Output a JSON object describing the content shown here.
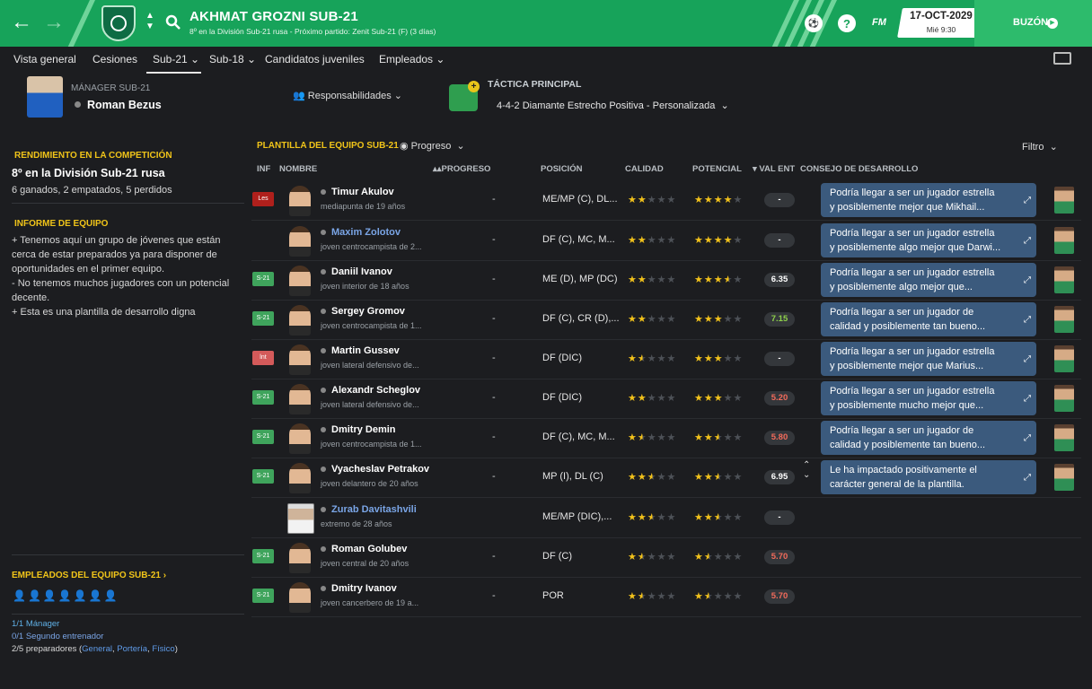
{
  "header": {
    "club": "AKHMAT GROZNI SUB-21",
    "subtitle": "8º en la División Sub-21 rusa - Próximo partido: Zenit Sub-21 (F)  (3 días)",
    "fm": "FM",
    "date": "17-OCT-2029",
    "time": "Mié 9:30",
    "inbox": "BUZÓN"
  },
  "tabs": [
    "Vista general",
    "Cesiones",
    "Sub-21",
    "Sub-18",
    "Candidatos juveniles",
    "Empleados"
  ],
  "manager": {
    "label": "MÁNAGER SUB-21",
    "name": "Roman Bezus",
    "responsibilities": "Responsabilidades"
  },
  "tactic": {
    "label": "TÁCTICA PRINCIPAL",
    "value": "4-4-2 Diamante Estrecho Positiva - Personalizada"
  },
  "competition": {
    "title": "RENDIMIENTO EN LA COMPETICIÓN",
    "position": "8º en la División Sub-21 rusa",
    "record": "6 ganados, 2 empatados, 5 perdidos"
  },
  "report": {
    "title": "INFORME DE EQUIPO",
    "lines": [
      "+ Tenemos aquí un grupo de jóvenes que están",
      "cerca de estar preparados ya para disponer de",
      "oportunidades en el primer equipo.",
      "- No tenemos muchos jugadores con un potencial",
      "decente.",
      "+ Esta es una plantilla de desarrollo digna"
    ]
  },
  "squad": {
    "title": "PLANTILLA DEL EQUIPO SUB-21",
    "view": "Progreso",
    "filter": "Filtro",
    "columns": {
      "inf": "INF",
      "name": "NOMBRE",
      "progress": "PROGRESO",
      "position": "POSICIÓN",
      "ability": "CALIDAD",
      "potential": "POTENCIAL",
      "value": "VAL ENT",
      "advice": "CONSEJO DE DESARROLLO"
    },
    "players": [
      {
        "inf": "Les",
        "inf_type": "les",
        "name": "Timur Akulov",
        "loan": false,
        "desc": "mediapunta de 19 años",
        "progress": "-",
        "position": "ME/MP (C), DL...",
        "ability": 2,
        "potential": 4,
        "rating": "-",
        "rating_color": "#ffffff",
        "advice": [
          "Podría llegar a ser un jugador estrella",
          "y posiblemente mejor que Mikhail..."
        ]
      },
      {
        "inf": "",
        "inf_type": "",
        "name": "Maxim Zolotov",
        "loan": true,
        "desc": "joven centrocampista de 2...",
        "progress": "-",
        "position": "DF (C), MC, M...",
        "ability": 2,
        "potential": 4,
        "rating": "-",
        "rating_color": "#ffffff",
        "advice": [
          "Podría llegar a ser un jugador estrella",
          "y posiblemente algo mejor que Darwi..."
        ]
      },
      {
        "inf": "S-21",
        "inf_type": "s21",
        "name": "Daniil Ivanov",
        "loan": false,
        "desc": "joven interior de 18 años",
        "progress": "-",
        "position": "ME (D), MP (DC)",
        "ability": 2,
        "potential": 3.5,
        "rating": "6.35",
        "rating_color": "#ffffff",
        "advice": [
          "Podría llegar a ser un jugador estrella",
          "y posiblemente algo mejor que..."
        ]
      },
      {
        "inf": "S-21",
        "inf_type": "s21",
        "name": "Sergey Gromov",
        "loan": false,
        "desc": "joven centrocampista de 1...",
        "progress": "-",
        "position": "DF (C), CR (D),...",
        "ability": 2,
        "potential": 3,
        "rating": "7.15",
        "rating_color": "#8ed14a",
        "advice": [
          "Podría llegar a ser un jugador de",
          "calidad y posiblemente tan bueno..."
        ]
      },
      {
        "inf": "lnt",
        "inf_type": "lnt",
        "name": "Martin Gussev",
        "loan": false,
        "desc": "joven lateral defensivo de...",
        "progress": "-",
        "position": "DF (DIC)",
        "ability": 1.5,
        "potential": 3,
        "rating": "-",
        "rating_color": "#ffffff",
        "advice": [
          "Podría llegar a ser un jugador estrella",
          "y posiblemente mejor que Marius..."
        ]
      },
      {
        "inf": "S-21",
        "inf_type": "s21",
        "name": "Alexandr Scheglov",
        "loan": false,
        "desc": "joven lateral defensivo de...",
        "progress": "-",
        "position": "DF (DIC)",
        "ability": 2,
        "potential": 3,
        "rating": "5.20",
        "rating_color": "#f26b5b",
        "advice": [
          "Podría llegar a ser un jugador estrella",
          "y posiblemente mucho mejor que..."
        ]
      },
      {
        "inf": "S-21",
        "inf_type": "s21",
        "name": "Dmitry Demin",
        "loan": false,
        "desc": "joven centrocampista de 1...",
        "progress": "-",
        "position": "DF (C), MC, M...",
        "ability": 1.5,
        "potential": 2.5,
        "rating": "5.80",
        "rating_color": "#f26b5b",
        "advice": [
          "Podría llegar a ser un jugador de",
          "calidad y posiblemente tan bueno..."
        ]
      },
      {
        "inf": "S-21",
        "inf_type": "s21",
        "name": "Vyacheslav Petrakov",
        "loan": false,
        "desc": "joven delantero de 20 años",
        "progress": "-",
        "position": "MP (I), DL (C)",
        "ability": 2.5,
        "potential": 2.5,
        "rating": "6.95",
        "rating_color": "#ffffff",
        "advice": [
          "Le ha impactado positivamente el",
          "carácter general de la plantilla."
        ]
      },
      {
        "inf": "",
        "inf_type": "",
        "name": "Zurab Davitashvili",
        "loan": true,
        "desc": "extremo de 28 años",
        "progress": "",
        "position": "ME/MP (DIC),...",
        "ability": 2.5,
        "potential": 2.5,
        "rating": "-",
        "rating_color": "#ffffff",
        "advice": []
      },
      {
        "inf": "S-21",
        "inf_type": "s21",
        "name": "Roman Golubev",
        "loan": false,
        "desc": "joven central de 20 años",
        "progress": "-",
        "position": "DF (C)",
        "ability": 1.5,
        "potential": 1.5,
        "rating": "5.70",
        "rating_color": "#f26b5b",
        "advice": []
      },
      {
        "inf": "S-21",
        "inf_type": "s21",
        "name": "Dmitry Ivanov",
        "loan": false,
        "desc": "joven cancerbero de 19 a...",
        "progress": "-",
        "position": "POR",
        "ability": 1.5,
        "potential": 1.5,
        "rating": "5.70",
        "rating_color": "#f26b5b",
        "advice": []
      }
    ]
  },
  "staff": {
    "title": "EMPLEADOS DEL EQUIPO SUB-21",
    "manager": "1/1 Mánager",
    "assistant": "0/1 Segundo entrenador",
    "coaches": "2/5 preparadores (",
    "c1": "General",
    "c2": "Portería",
    "c3": "Físico",
    "close": ")"
  }
}
